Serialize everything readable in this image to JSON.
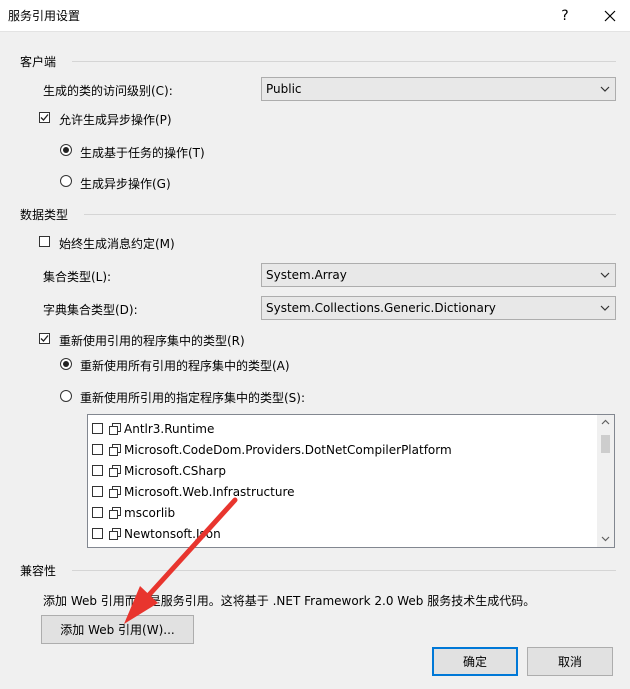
{
  "window": {
    "title": "服务引用设置",
    "help_icon": "question-mark-icon",
    "close_icon": "close-icon"
  },
  "client": {
    "header": "客户端",
    "access_level_label": "生成的类的访问级别(C):",
    "access_level_value": "Public",
    "allow_async_label": "允许生成异步操作(P)",
    "allow_async_checked": true,
    "task_ops_label": "生成基于任务的操作(T)",
    "task_ops_selected": true,
    "async_ops_label": "生成异步操作(G)",
    "async_ops_selected": false
  },
  "datatype": {
    "header": "数据类型",
    "always_gen_contracts_label": "始终生成消息约定(M)",
    "always_gen_contracts_checked": false,
    "collection_label": "集合类型(L):",
    "collection_value": "System.Array",
    "dict_label": "字典集合类型(D):",
    "dict_value": "System.Collections.Generic.Dictionary",
    "reuse_types_label": "重新使用引用的程序集中的类型(R)",
    "reuse_types_checked": true,
    "reuse_all_label": "重新使用所有引用的程序集中的类型(A)",
    "reuse_all_selected": true,
    "reuse_specified_label": "重新使用所引用的指定程序集中的类型(S):",
    "reuse_specified_selected": false,
    "assemblies": [
      {
        "name": "Antlr3.Runtime",
        "checked": false
      },
      {
        "name": "Microsoft.CodeDom.Providers.DotNetCompilerPlatform",
        "checked": false
      },
      {
        "name": "Microsoft.CSharp",
        "checked": false
      },
      {
        "name": "Microsoft.Web.Infrastructure",
        "checked": false
      },
      {
        "name": "mscorlib",
        "checked": false
      },
      {
        "name": "Newtonsoft.Json",
        "checked": false
      }
    ]
  },
  "compat": {
    "header": "兼容性",
    "description": "添加 Web 引用而不是服务引用。这将基于 .NET Framework 2.0 Web 服务技术生成代码。",
    "add_web_ref_label": "添加 Web 引用(W)..."
  },
  "footer": {
    "ok_label": "确定",
    "cancel_label": "取消"
  },
  "colors": {
    "annotation_arrow": "#e8352e",
    "default_button_border": "#0078d7"
  }
}
